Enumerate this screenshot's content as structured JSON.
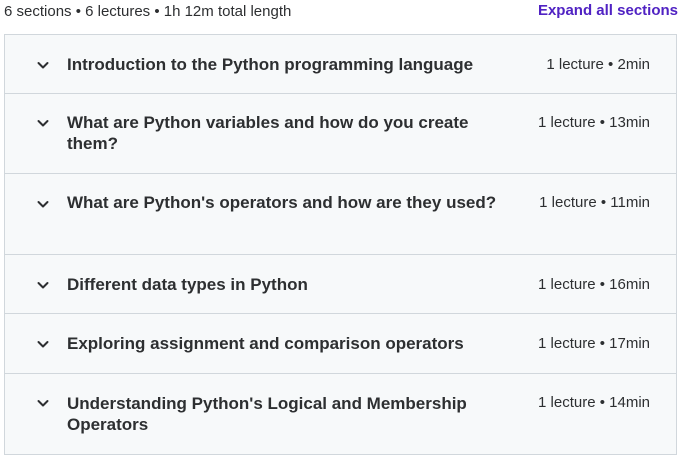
{
  "header": {
    "summary": "6 sections • 6 lectures • 1h 12m total length",
    "expand_all_label": "Expand all sections"
  },
  "sections": [
    {
      "title": "Introduction to the Python programming language",
      "meta": "1 lecture • 2min"
    },
    {
      "title": "What are Python variables and how do you create them?",
      "meta": "1 lecture • 13min"
    },
    {
      "title": "What are Python's operators and how are they used?",
      "meta": "1 lecture • 11min"
    },
    {
      "title": "Different data types in Python",
      "meta": "1 lecture • 16min"
    },
    {
      "title": "Exploring assignment and comparison operators",
      "meta": "1 lecture • 17min"
    },
    {
      "title": "Understanding Python's Logical and Membership Operators",
      "meta": "1 lecture • 14min"
    }
  ],
  "icons": {
    "section_toggle": "chevron-down-icon"
  },
  "colors": {
    "accent": "#5022c3",
    "panel_background": "#f7f9fa",
    "border": "#d1d7dc",
    "text": "#2d2f31"
  }
}
